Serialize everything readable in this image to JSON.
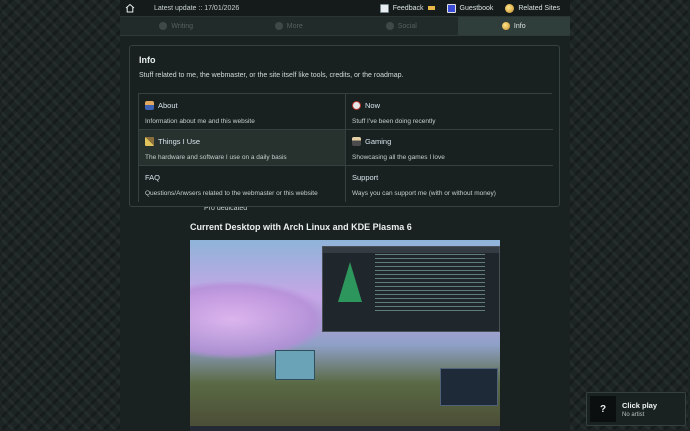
{
  "topbar": {
    "latest_update": "Latest update :: 17/01/2026",
    "links": {
      "feedback": "Feedback",
      "guestbook": "Guestbook",
      "related": "Related Sites"
    }
  },
  "tabs": [
    {
      "label": "Writing",
      "active": false
    },
    {
      "label": "More",
      "active": false
    },
    {
      "label": "Social",
      "active": false
    },
    {
      "label": "Info",
      "active": true
    }
  ],
  "panel": {
    "title": "Info",
    "description": "Stuff related to me, the webmaster, or the site itself like tools, credits, or the roadmap.",
    "items": [
      {
        "icon": "person-icon",
        "label": "About",
        "desc": "Information about me and this website"
      },
      {
        "icon": "alarm-clock-icon",
        "label": "Now",
        "desc": "Stuff I've been doing recently"
      },
      {
        "icon": "tools-icon",
        "label": "Things I Use",
        "desc": "The hardware and software I use on a daily basis"
      },
      {
        "icon": "gamer-icon",
        "label": "Gaming",
        "desc": "Showcasing all the games I love"
      },
      {
        "icon": "",
        "label": "FAQ",
        "desc": "Questions/Anwsers related to the webmaster or this website"
      },
      {
        "icon": "",
        "label": "Support",
        "desc": "Ways you can support me (with or without money)"
      }
    ]
  },
  "article": {
    "partial_text": "Pro dedicated",
    "heading": "Current Desktop with Arch Linux and KDE Plasma 6"
  },
  "music": {
    "art_glyph": "?",
    "title": "Click play",
    "artist": "No artist"
  },
  "colors": {
    "background": "#1d2424",
    "panel": "#182120",
    "accent_link": "#d7e4ee"
  }
}
